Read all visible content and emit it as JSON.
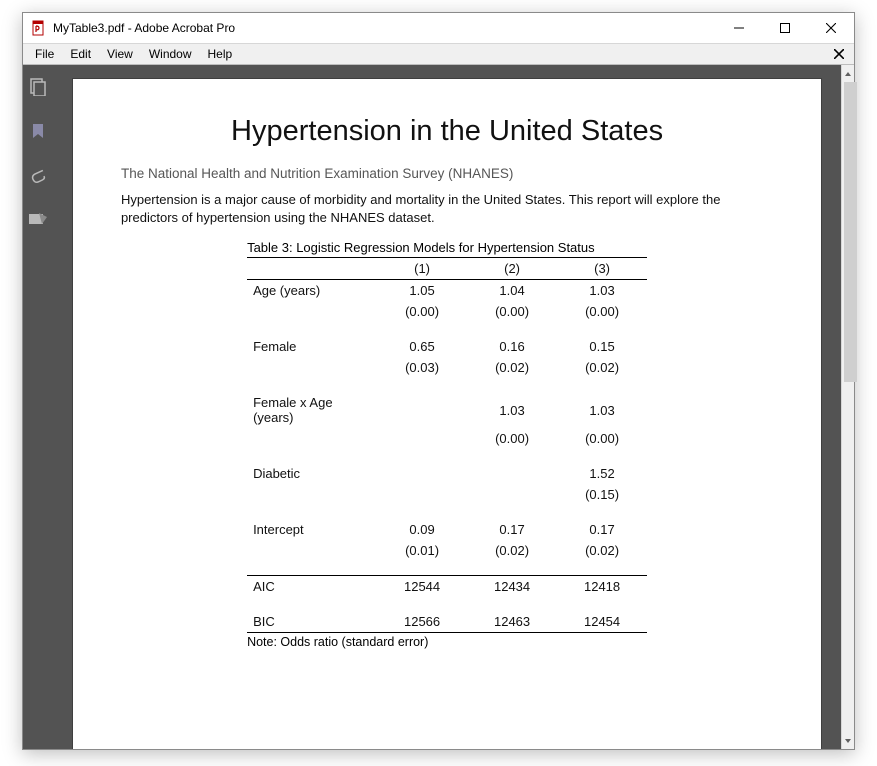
{
  "window": {
    "title": "MyTable3.pdf - Adobe Acrobat Pro"
  },
  "menu": {
    "items": [
      "File",
      "Edit",
      "View",
      "Window",
      "Help"
    ]
  },
  "sidebar": {
    "icons": [
      "thumbnails-icon",
      "bookmark-icon",
      "attachment-icon",
      "signature-icon"
    ]
  },
  "document": {
    "title": "Hypertension in the United States",
    "subtitle": "The National Health and Nutrition Examination Survey (NHANES)",
    "body": "Hypertension is a major cause of morbidity and mortality in the United States.  This report will explore the predictors of hypertension using the NHANES dataset.",
    "table": {
      "caption": "Table 3: Logistic Regression Models for Hypertension Status",
      "columns": [
        "(1)",
        "(2)",
        "(3)"
      ],
      "rows": [
        {
          "label": "Age (years)",
          "vals": [
            "1.05",
            "1.04",
            "1.03"
          ],
          "se": [
            "(0.00)",
            "(0.00)",
            "(0.00)"
          ]
        },
        {
          "label": "Female",
          "vals": [
            "0.65",
            "0.16",
            "0.15"
          ],
          "se": [
            "(0.03)",
            "(0.02)",
            "(0.02)"
          ]
        },
        {
          "label": "Female x Age (years)",
          "vals": [
            "",
            "1.03",
            "1.03"
          ],
          "se": [
            "",
            "(0.00)",
            "(0.00)"
          ]
        },
        {
          "label": "Diabetic",
          "vals": [
            "",
            "",
            "1.52"
          ],
          "se": [
            "",
            "",
            "(0.15)"
          ]
        },
        {
          "label": "Intercept",
          "vals": [
            "0.09",
            "0.17",
            "0.17"
          ],
          "se": [
            "(0.01)",
            "(0.02)",
            "(0.02)"
          ]
        }
      ],
      "stats": [
        {
          "label": "AIC",
          "vals": [
            "12544",
            "12434",
            "12418"
          ]
        },
        {
          "label": "BIC",
          "vals": [
            "12566",
            "12463",
            "12454"
          ]
        }
      ],
      "note": "Note: Odds ratio (standard error)"
    }
  }
}
